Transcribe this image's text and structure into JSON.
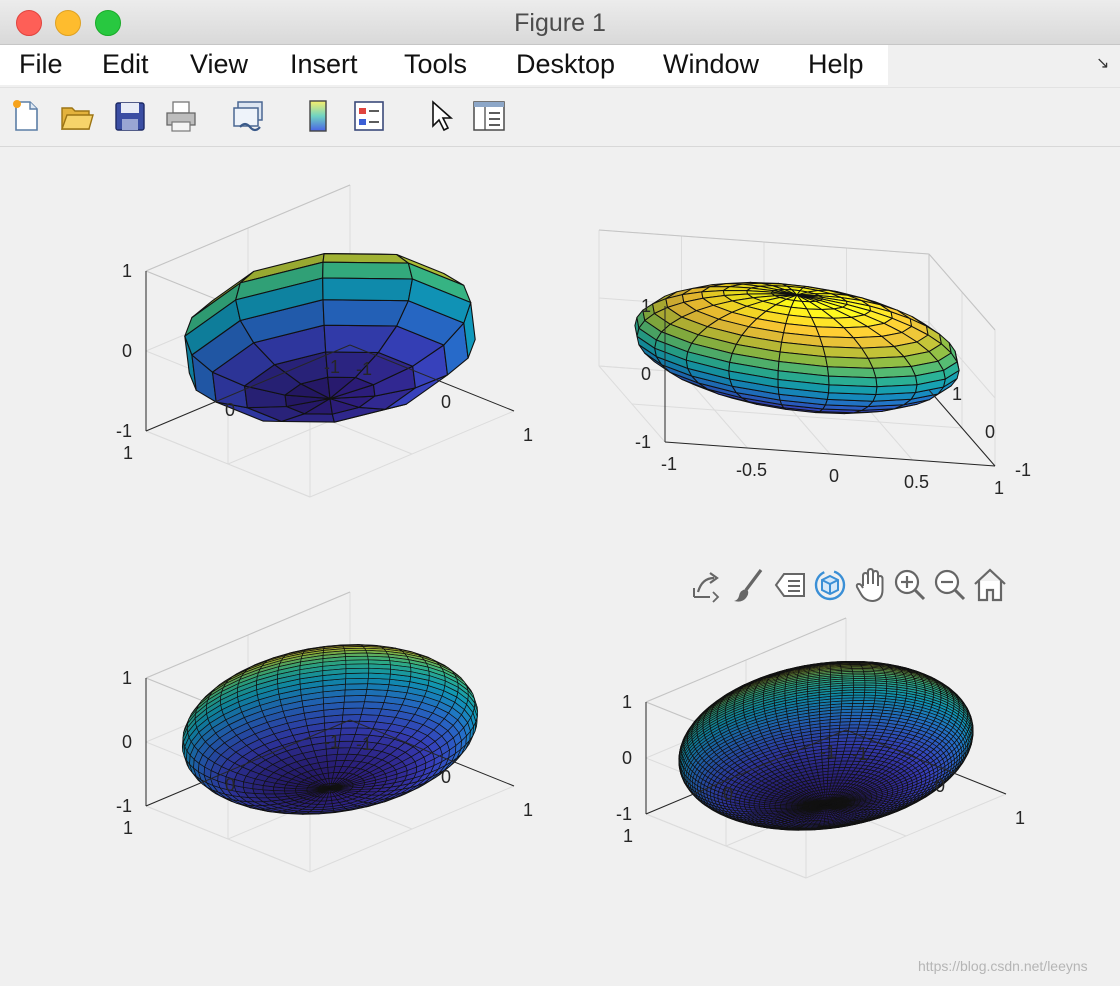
{
  "window": {
    "title": "Figure 1",
    "watermark": "https://blog.csdn.net/leeyns"
  },
  "menubar": {
    "items": [
      "File",
      "Edit",
      "View",
      "Insert",
      "Tools",
      "Desktop",
      "Window",
      "Help"
    ]
  },
  "toolbar": {
    "buttons": [
      "new-figure-icon",
      "open-file-icon",
      "save-icon",
      "print-icon",
      "link-plot-icon",
      "colorbar-icon",
      "legend-icon",
      "edit-plot-pointer-icon",
      "property-inspector-icon"
    ]
  },
  "axes_toolbar": {
    "buttons": [
      "export-icon",
      "brush-icon",
      "data-tips-icon",
      "rotate-3d-icon",
      "pan-icon",
      "zoom-in-icon",
      "zoom-out-icon",
      "home-icon"
    ],
    "active": "rotate-3d-icon",
    "active_color": "#3a8fd6"
  },
  "chart_data": [
    {
      "type": "surface",
      "shape": "ellipsoid",
      "mesh_n": 10,
      "x_ticks": [
        "-1",
        "0",
        "1"
      ],
      "y_ticks": [
        "-1",
        "0",
        "1"
      ],
      "z_ticks": [
        "-1",
        "0",
        "1"
      ],
      "xlim": [
        -1,
        1
      ],
      "ylim": [
        -1,
        1
      ],
      "zlim": [
        -1,
        1
      ],
      "view": "default 3-D",
      "grid": "on",
      "colormap": "parula"
    },
    {
      "type": "surface",
      "shape": "ellipsoid",
      "mesh_n": 20,
      "x_ticks": [
        "-1",
        "-0.5",
        "0",
        "0.5",
        "1"
      ],
      "y_ticks": [
        "-1",
        "0",
        "1"
      ],
      "z_ticks": [
        "-1",
        "0",
        "1"
      ],
      "xlim": [
        -1,
        1
      ],
      "ylim": [
        -1,
        1
      ],
      "zlim": [
        -1,
        1
      ],
      "view": "rotated",
      "grid": "on",
      "colormap": "parula"
    },
    {
      "type": "surface",
      "shape": "ellipsoid",
      "mesh_n": 40,
      "x_ticks": [
        "-1",
        "0",
        "1"
      ],
      "y_ticks": [
        "-1",
        "0",
        "1"
      ],
      "z_ticks": [
        "-1",
        "0",
        "1"
      ],
      "xlim": [
        -1,
        1
      ],
      "ylim": [
        -1,
        1
      ],
      "zlim": [
        -1,
        1
      ],
      "view": "default 3-D",
      "grid": "on",
      "colormap": "parula"
    },
    {
      "type": "surface",
      "shape": "ellipsoid",
      "mesh_n": 80,
      "x_ticks": [
        "-1",
        "0",
        "1"
      ],
      "y_ticks": [
        "-1",
        "0",
        "1"
      ],
      "z_ticks": [
        "-1",
        "0",
        "1"
      ],
      "xlim": [
        -1,
        1
      ],
      "ylim": [
        -1,
        1
      ],
      "zlim": [
        -1,
        1
      ],
      "view": "default 3-D",
      "grid": "on",
      "colormap": "parula"
    }
  ]
}
